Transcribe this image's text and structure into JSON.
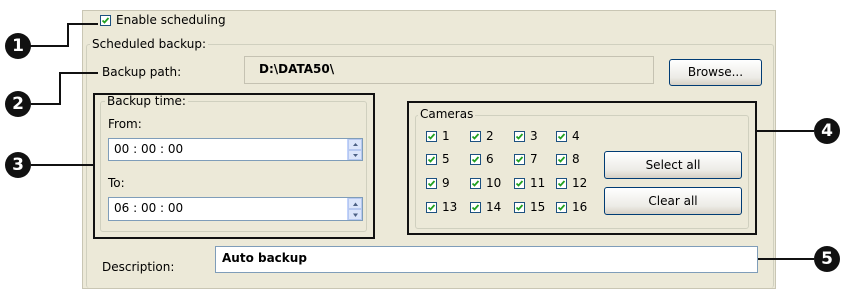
{
  "enable_scheduling": {
    "label": "Enable scheduling",
    "checked": true
  },
  "scheduled_backup": {
    "title": "Scheduled backup:",
    "backup_path_label": "Backup path:",
    "backup_path_value": "D:\\DATA50\\",
    "browse_label": "Browse...",
    "backup_time": {
      "title": "Backup time:",
      "from_label": "From:",
      "from_value": "00 : 00 : 00",
      "to_label": "To:",
      "to_value": "06 : 00 : 00"
    },
    "cameras": {
      "title": "Cameras",
      "items": [
        "1",
        "2",
        "3",
        "4",
        "5",
        "6",
        "7",
        "8",
        "9",
        "10",
        "11",
        "12",
        "13",
        "14",
        "15",
        "16"
      ],
      "select_all_label": "Select all",
      "clear_all_label": "Clear all"
    },
    "description_label": "Description:",
    "description_value": "Auto backup"
  },
  "callouts": [
    "1",
    "2",
    "3",
    "4",
    "5"
  ]
}
